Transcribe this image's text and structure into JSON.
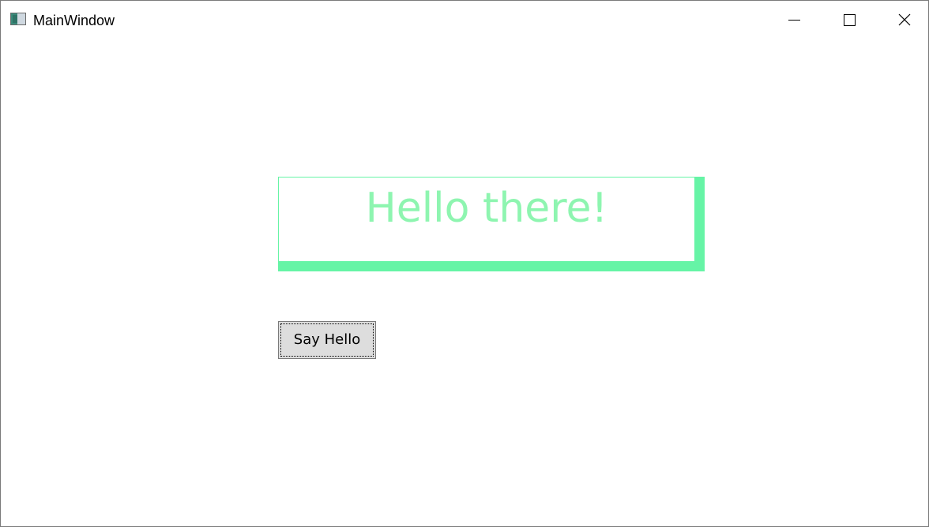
{
  "window": {
    "title": "MainWindow",
    "icon": "app-window-icon",
    "controls": {
      "minimize": "minimize-icon",
      "maximize": "maximize-icon",
      "close": "close-icon"
    }
  },
  "main": {
    "greeting_text": "Hello there!",
    "greeting_color": "#8ef5b0",
    "border_color": "#66f4a6",
    "say_hello_label": "Say Hello"
  }
}
